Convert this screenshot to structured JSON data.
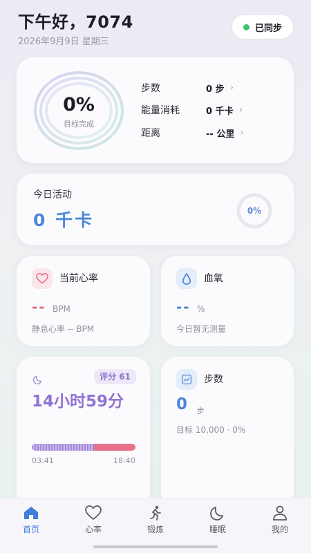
{
  "header": {
    "greeting": "下午好，7074",
    "date": "2026年9月9日 星期三",
    "sync_label": "已同步"
  },
  "summary": {
    "ring_percent": "0%",
    "ring_label": "目标完成",
    "stats": [
      {
        "name": "步数",
        "value": "0 步"
      },
      {
        "name": "能量消耗",
        "value": "0 千卡"
      },
      {
        "name": "距离",
        "value": "-- 公里"
      }
    ]
  },
  "activity": {
    "title": "今日活动",
    "value": "0 千卡",
    "percent": "0%"
  },
  "heart_rate": {
    "title": "当前心率",
    "value": "--",
    "unit": "BPM",
    "resting": "静息心率 -- BPM",
    "color": "#e36a80"
  },
  "blood_oxygen": {
    "title": "血氧",
    "value": "--",
    "unit": "%",
    "note": "今日暂无测量",
    "color": "#4a86d8"
  },
  "sleep": {
    "score": "评分 61",
    "duration": "14小时59分",
    "start": "03:41",
    "end": "18:40",
    "deep_fraction": 0.6,
    "color": "#9272d2"
  },
  "steps_card": {
    "title": "步数",
    "value": "0",
    "unit": "步",
    "goal": "目标 10,000 · 0%"
  },
  "tabs": [
    {
      "label": "首页",
      "icon": "home-icon",
      "active": true
    },
    {
      "label": "心率",
      "icon": "heart-icon",
      "active": false
    },
    {
      "label": "锻炼",
      "icon": "run-icon",
      "active": false
    },
    {
      "label": "睡眠",
      "icon": "moon-icon",
      "active": false
    },
    {
      "label": "我的",
      "icon": "user-icon",
      "active": false
    }
  ]
}
